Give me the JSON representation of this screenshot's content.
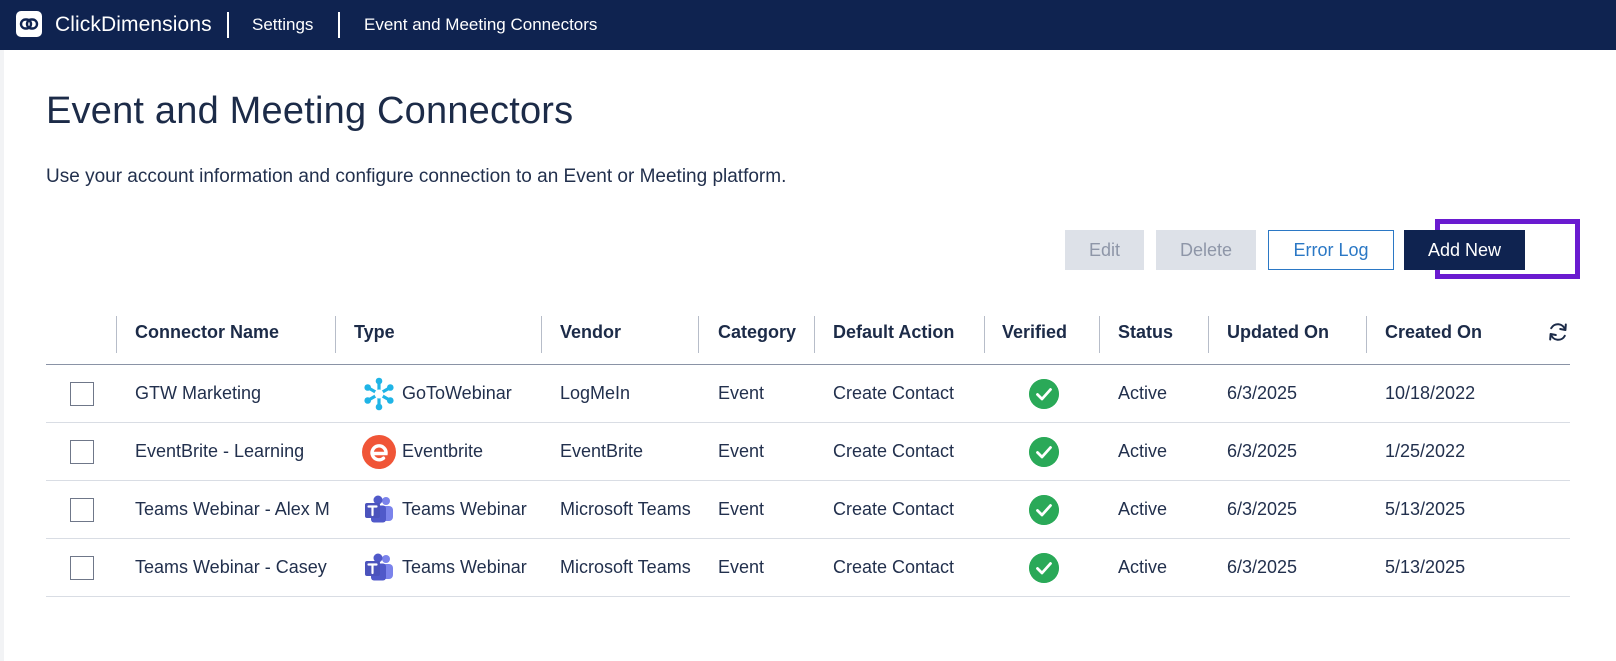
{
  "topbar": {
    "brand": "ClickDimensions",
    "breadcrumbs": [
      "Settings",
      "Event and Meeting Connectors"
    ]
  },
  "page": {
    "title": "Event and Meeting Connectors",
    "description": "Use your account information and configure connection to an Event or Meeting platform."
  },
  "toolbar": {
    "edit_label": "Edit",
    "delete_label": "Delete",
    "error_log_label": "Error Log",
    "add_new_label": "Add New"
  },
  "table": {
    "columns": [
      "Connector Name",
      "Type",
      "Vendor",
      "Category",
      "Default Action",
      "Verified",
      "Status",
      "Updated On",
      "Created On"
    ],
    "rows": [
      {
        "name": "GTW Marketing",
        "type": "GoToWebinar",
        "type_icon": "gotowebinar-icon",
        "vendor": "LogMeIn",
        "category": "Event",
        "default_action": "Create Contact",
        "verified": true,
        "status": "Active",
        "updated_on": "6/3/2025",
        "created_on": "10/18/2022"
      },
      {
        "name": "EventBrite - Learning",
        "type": "Eventbrite",
        "type_icon": "eventbrite-icon",
        "vendor": "EventBrite",
        "category": "Event",
        "default_action": "Create Contact",
        "verified": true,
        "status": "Active",
        "updated_on": "6/3/2025",
        "created_on": "1/25/2022"
      },
      {
        "name": "Teams Webinar - Alex M",
        "type": "Teams Webinar",
        "type_icon": "teams-icon",
        "vendor": "Microsoft Teams",
        "category": "Event",
        "default_action": "Create Contact",
        "verified": true,
        "status": "Active",
        "updated_on": "6/3/2025",
        "created_on": "5/13/2025"
      },
      {
        "name": "Teams Webinar - Casey",
        "type": "Teams Webinar",
        "type_icon": "teams-icon",
        "vendor": "Microsoft Teams",
        "category": "Event",
        "default_action": "Create Contact",
        "verified": true,
        "status": "Active",
        "updated_on": "6/3/2025",
        "created_on": "5/13/2025"
      }
    ]
  },
  "colors": {
    "topbar": "#0f2350",
    "primary_button": "#0f2350",
    "highlight": "#6a1bd0",
    "verified": "#2aa958",
    "link": "#2b78c5"
  }
}
